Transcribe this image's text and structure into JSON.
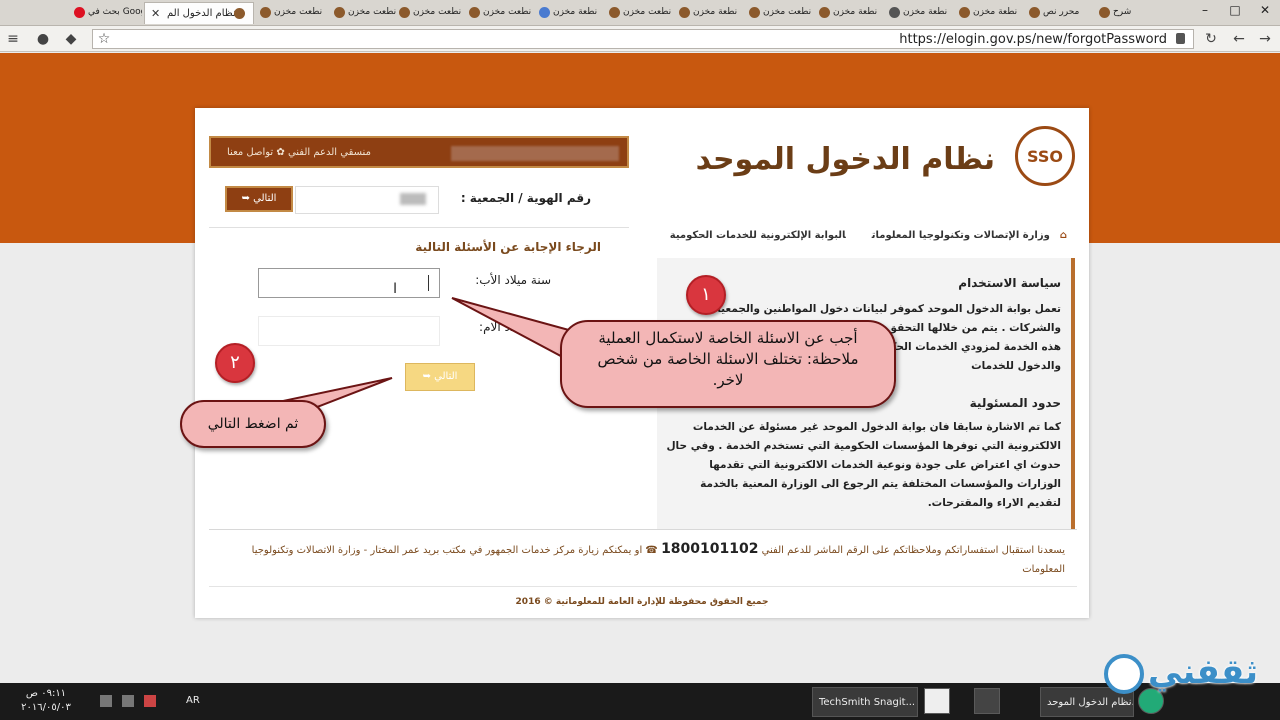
{
  "browser": {
    "active_tab_title": "نظام الدخول الم",
    "tabs": [
      "بحث في Google",
      "نطعت مخزن",
      "محرر نص",
      "نطعت مخزن",
      "شرح",
      "نطعت مخزن",
      "نطعت مخزن",
      "نطعة مخزن",
      "نطعت مخزن",
      "نطعة مخزن",
      "نطعت مخزن",
      "نطعة مخزن",
      "نطعة مخزن",
      "نطعة مخزن"
    ],
    "url": "https://elogin.gov.ps/new/forgotPassword"
  },
  "site": {
    "logo_text": "SSO",
    "title": "نظام الدخول الموحد",
    "top_links": [
      "وزارة الإتصالات وتكنولوجيا المعلومات",
      "البوابة الإلكترونية للخدمات الحكومية"
    ],
    "header": {
      "contact": "منسقي الدعم الفني ✿ تواصل معنا"
    }
  },
  "form": {
    "id_label": "رقم الهوية / الجمعية :",
    "next_label": "التالي",
    "instructions": "الرجاء الإجابة عن الأسئلة التالية",
    "q1_label": "سنة ميلاد الأب:",
    "q1_value": "",
    "q2_label": "سنة ميلاد الام:",
    "q2_value": ""
  },
  "policy": {
    "usage_title": "سياسة الاستخدام",
    "usage_text": "تعمل بوابة الدخول الموحد كموفر لبيانات دخول المواطنين والجمعيات والشركات . يتم من خلالها التحقق من بيانات الدخول للمستخدمين يتم توفير هذه الخدمة لمزودي الخدمات الحكومية الإلكترونية لتسهيل عمليات التسجيل والدخول للخدمات",
    "liability_title": "حدود المسئولية",
    "liability_text": "كما تم الاشارة سابقا فان بوابة الدخول الموحد غير مسئولة عن الخدمات الالكترونية التي توفرها المؤسسات الحكومية التي تستخدم الخدمة . وفي حال حدوث اي اعتراض على جودة ونوعية الخدمات الالكترونية التي تقدمها الوزارات والمؤسسات المختلفة يتم الرجوع الى الوزارة المعنية بالخدمة لتقديم الاراء والمقترحات."
  },
  "footer": {
    "help_before": "يسعدنا استقبال استفساراتكم وملاحظاتكم على الرقم الماشر للدعم الفني",
    "phone": "1800101102",
    "help_after": "او يمكنكم زيارة مركز خدمات الجمهور في مكتب بريد عمر المختار - وزارة الاتصالات وتكنولوجيا المعلومات",
    "copyright": "جميع الحقوق محفوظة للإدارة العامة للمعلوماتية © 2016"
  },
  "annotations": {
    "step1": "١",
    "step2": "٢",
    "bubble1_line1": "أجب عن الاسئلة الخاصة لاستكمال العملية",
    "bubble1_line2": "ملاحظة: تختلف الاسئلة الخاصة من شخص",
    "bubble1_line3": "لاخر.",
    "bubble2": "ثم اضغط التالي"
  },
  "taskbar": {
    "time": "٠٩:١١ ص",
    "date": "٢٠١٦/٠٥/٠٣",
    "lang": "AR",
    "tasks": [
      "TechSmith Snagit...",
      "نظام الدخول الموحد..."
    ]
  },
  "watermark": "ثقفني",
  "colors": {
    "brand_brown": "#8e3f12",
    "band_orange": "#c8580f",
    "accent_gold": "#c38a45",
    "annotation_red": "#d9363e"
  }
}
